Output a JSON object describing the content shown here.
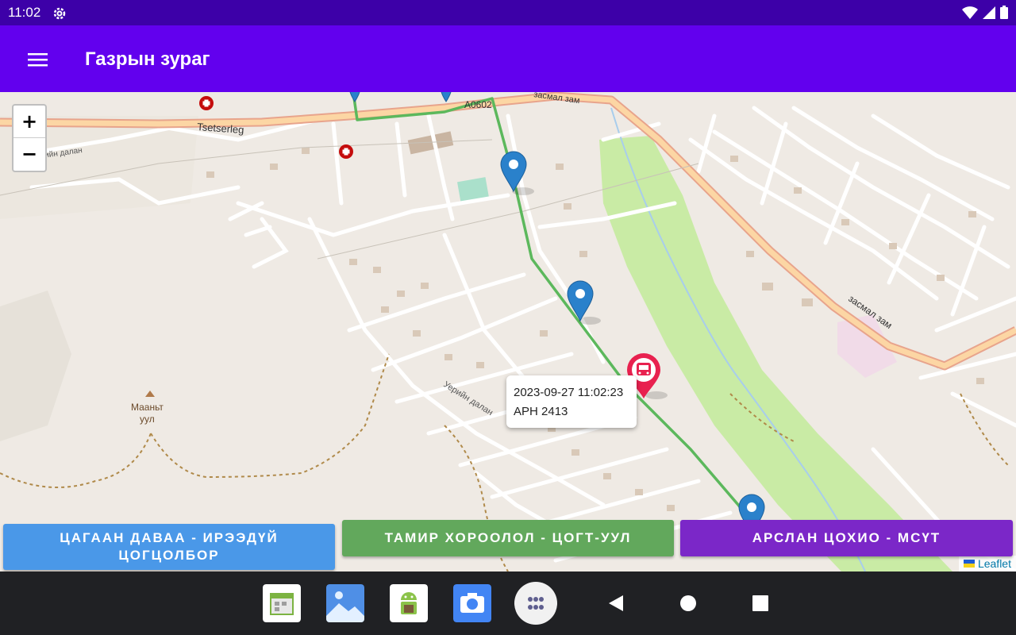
{
  "status_bar": {
    "time": "11:02",
    "icons": [
      "settings-gear-icon",
      "wifi-icon",
      "signal-icon",
      "battery-icon"
    ]
  },
  "app_bar": {
    "title": "Газрын зураг",
    "menu_icon": "hamburger-menu-icon",
    "color": "#6200ee"
  },
  "map": {
    "zoom_in_label": "+",
    "zoom_out_label": "−",
    "labels": {
      "road_tsetserleg": "Tsetserleg",
      "road_a0602": "A0602",
      "road_zasmal_zam": "засмал зам",
      "road_zasmal_top": "засмал зам",
      "valley_1": "Уерийн далан",
      "valley_2": "Уерийн далан",
      "mountain_line1": "Мааньт",
      "mountain_line2": "уул"
    },
    "popup": {
      "timestamp": "2023-09-27 11:02:23",
      "plate": "АРН 2413"
    },
    "attribution": "Leaflet",
    "route_color": "#5cb85c",
    "bus_marker_color": "#e8214f",
    "stop_marker_color": "#2a81cb"
  },
  "route_buttons": [
    {
      "label": "ЦАГААН ДАВАА - ИРЭЭДҮЙ ЦОГЦОЛБОР",
      "color": "#4a98e8"
    },
    {
      "label": "ТАМИР ХОРООЛОЛ - ЦОГТ-УУЛ",
      "color": "#62a85c"
    },
    {
      "label": "АРСЛАН ЦОХИО - МСҮТ",
      "color": "#7b27c8"
    }
  ],
  "nav_bar": {
    "dock_apps": [
      "calendar-app-icon",
      "gallery-app-icon",
      "android-app-icon",
      "camera-app-icon",
      "app-drawer-icon"
    ],
    "buttons": [
      "back-icon",
      "home-icon",
      "recents-icon"
    ]
  }
}
